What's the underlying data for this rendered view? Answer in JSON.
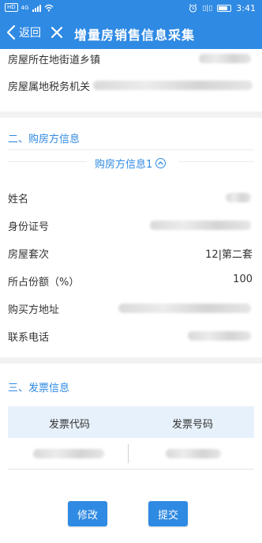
{
  "status_bar": {
    "network_badge": "HD",
    "network_type": "4G",
    "time": "3:41",
    "vibrate_badge": "▯|▯"
  },
  "nav": {
    "back_label": "返回",
    "title": "增量房销售信息采集"
  },
  "property": {
    "street_label": "房屋所在地街道乡镇",
    "tax_office_label": "房屋属地税务机关"
  },
  "buyer_section": {
    "title": "二、购房方信息",
    "subheader": "购房方信息1",
    "name_label": "姓名",
    "id_label": "身份证号",
    "house_count_label": "房屋套次",
    "house_count_value": "12|第二套",
    "share_label": "所占份额（%）",
    "share_value": "100",
    "address_label": "购买方地址",
    "phone_label": "联系电话"
  },
  "invoice_section": {
    "title": "三、发票信息",
    "col_code": "发票代码",
    "col_number": "发票号码"
  },
  "actions": {
    "modify_label": "修改",
    "submit_label": "提交"
  },
  "colors": {
    "primary": "#2f8ae3",
    "table_header_bg": "#e7f1fb",
    "separator": "#f2f2f2"
  }
}
